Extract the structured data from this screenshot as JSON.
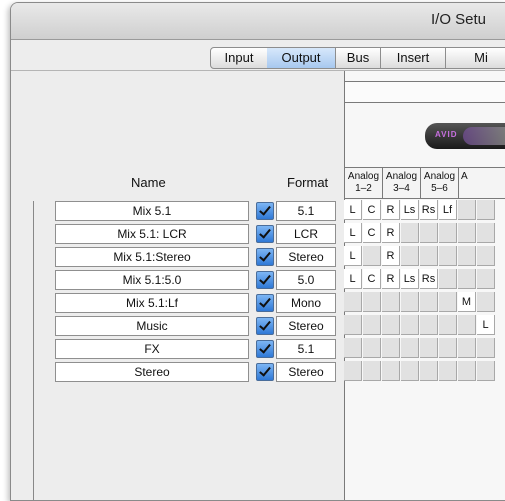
{
  "window": {
    "title": "I/O Setu"
  },
  "tabs": [
    {
      "label": "Input",
      "active": false
    },
    {
      "label": "Output",
      "active": true
    },
    {
      "label": "Bus",
      "active": false
    },
    {
      "label": "Insert",
      "active": false
    },
    {
      "label": "Mi",
      "active": false
    }
  ],
  "headers": {
    "name": "Name",
    "format": "Format"
  },
  "device": {
    "logo": "AVID"
  },
  "column_groups": [
    {
      "label": "Analog",
      "channels": "1–2"
    },
    {
      "label": "Analog",
      "channels": "3–4"
    },
    {
      "label": "Analog",
      "channels": "5–6"
    },
    {
      "label": "A",
      "channels": ""
    }
  ],
  "paths": [
    {
      "name": "Mix 5.1",
      "enabled": true,
      "format": "5.1",
      "cells": [
        "L",
        "C",
        "R",
        "Ls",
        "Rs",
        "Lf",
        "",
        ""
      ]
    },
    {
      "name": "Mix 5.1: LCR",
      "enabled": true,
      "format": "LCR",
      "cells": [
        "L",
        "C",
        "R",
        "",
        "",
        "",
        "",
        ""
      ]
    },
    {
      "name": "Mix 5.1:Stereo",
      "enabled": true,
      "format": "Stereo",
      "cells": [
        "L",
        "",
        "R",
        "",
        "",
        "",
        "",
        ""
      ]
    },
    {
      "name": "Mix 5.1:5.0",
      "enabled": true,
      "format": "5.0",
      "cells": [
        "L",
        "C",
        "R",
        "Ls",
        "Rs",
        "",
        "",
        ""
      ]
    },
    {
      "name": "Mix 5.1:Lf",
      "enabled": true,
      "format": "Mono",
      "cells": [
        "",
        "",
        "",
        "",
        "",
        "",
        "M",
        ""
      ]
    },
    {
      "name": "Music",
      "enabled": true,
      "format": "Stereo",
      "cells": [
        "",
        "",
        "",
        "",
        "",
        "",
        "",
        "L"
      ]
    },
    {
      "name": "FX",
      "enabled": true,
      "format": "5.1",
      "cells": [
        "",
        "",
        "",
        "",
        "",
        "",
        "",
        ""
      ]
    },
    {
      "name": "Stereo",
      "enabled": true,
      "format": "Stereo",
      "cells": [
        "",
        "",
        "",
        "",
        "",
        "",
        "",
        ""
      ]
    }
  ],
  "colors": {
    "checkbox": "#2f78d6",
    "active_tab": "#a7c8ef"
  }
}
